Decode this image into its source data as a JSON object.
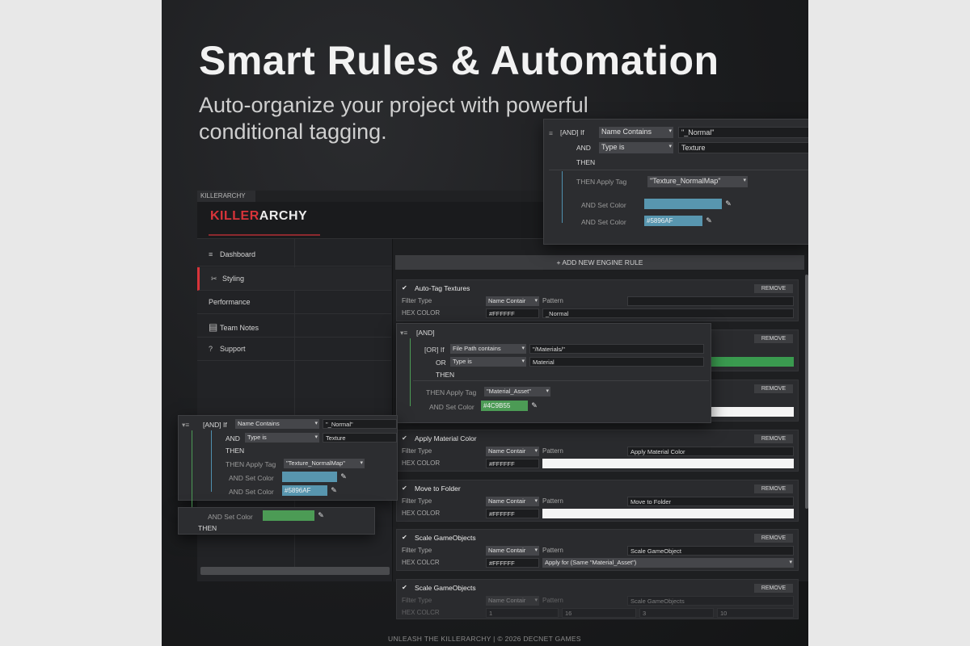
{
  "headline": "Smart Rules & Automation",
  "subline": "Auto-organize your project with powerful conditional tagging.",
  "window": {
    "tab": "KILLERARCHY",
    "logo_a": "KILLER",
    "logo_b": "ARCHY"
  },
  "sidebar": {
    "items": [
      {
        "icon": "≡",
        "label": "Dashboard"
      },
      {
        "icon": "✂",
        "label": "Styling"
      },
      {
        "icon": "",
        "label": "Performance"
      },
      {
        "icon": "▤",
        "label": "Team Notes"
      },
      {
        "icon": "?",
        "label": "Support"
      }
    ]
  },
  "add_rule_label": "+ ADD NEW ENGINE RULE",
  "labels": {
    "filter_type": "Filter Type",
    "pattern": "Pattern",
    "hex_color": "HEX COLOR",
    "hex_colcr": "HEX COLCR",
    "remove": "REMOVE",
    "check": "✔"
  },
  "rules": [
    {
      "title": "Auto-Tag Textures",
      "filter": "Name Contair",
      "pattern": "",
      "hex": "#FFFFFF",
      "value": "_Normal"
    },
    {
      "title": "Apply Material Color",
      "filter": "Name Contair",
      "pattern": "Apply Material Color",
      "hex": "#FFFFFF"
    },
    {
      "title": "Move to Folder",
      "filter": "Name Contair",
      "pattern": "Move to Folder",
      "hex": "#FFFFFF"
    },
    {
      "title": "Scale GameObjects",
      "filter": "Name Contair",
      "pattern": "Scale GameObject",
      "hex": "#FFFFFF",
      "value": "Apply for (Same \"Material_Asset\")"
    },
    {
      "title": "Scale GameObjects",
      "filter": "Name Contair",
      "pattern": "Scale GameObjects",
      "hex_values": [
        "1",
        "16",
        "3",
        "10"
      ]
    }
  ],
  "popup_top": {
    "and_if": "[AND] If",
    "dd1": "Name Contains",
    "val1": "\"_Normal\"",
    "and": "AND",
    "dd2": "Type is",
    "val2": "Texture",
    "then": "THEN",
    "then_apply": "THEN Apply Tag",
    "tag": "\"Texture_NormalMap\"",
    "and_set_color": "AND Set Color",
    "hex": "#5896AF"
  },
  "popup_mid": {
    "and": "[AND]",
    "or_if": "[OR] If",
    "dd1": "File Path contains",
    "val1": "\"/Materials/\"",
    "or": "OR",
    "dd2": "Type is",
    "val2": "Material",
    "then": "THEN",
    "then_apply": "THEN Apply Tag",
    "tag": "\"Material_Asset\"",
    "and_set_color": "AND Set Color",
    "hex": "#4C9B55"
  },
  "popup_left": {
    "and_if": "[AND] If",
    "dd1": "Name Contains",
    "val1": "\"_Normal\"",
    "and": "AND",
    "dd2": "Type is",
    "val2": "Texture",
    "then": "THEN",
    "then_apply": "THEN Apply Tag",
    "tag": "\"Texture_NormalMap\"",
    "and_set_color": "AND Set Color",
    "hex": "#5896AF"
  },
  "popup_bottom": {
    "and_set_color": "AND Set Color",
    "then": "THEN"
  },
  "footer": "UNLEASH THE KILLERARCHY  |  © 2026 DECNET GAMES",
  "colors": {
    "accent": "#d9343a",
    "blue": "#5896AF",
    "green": "#4C9B55"
  }
}
